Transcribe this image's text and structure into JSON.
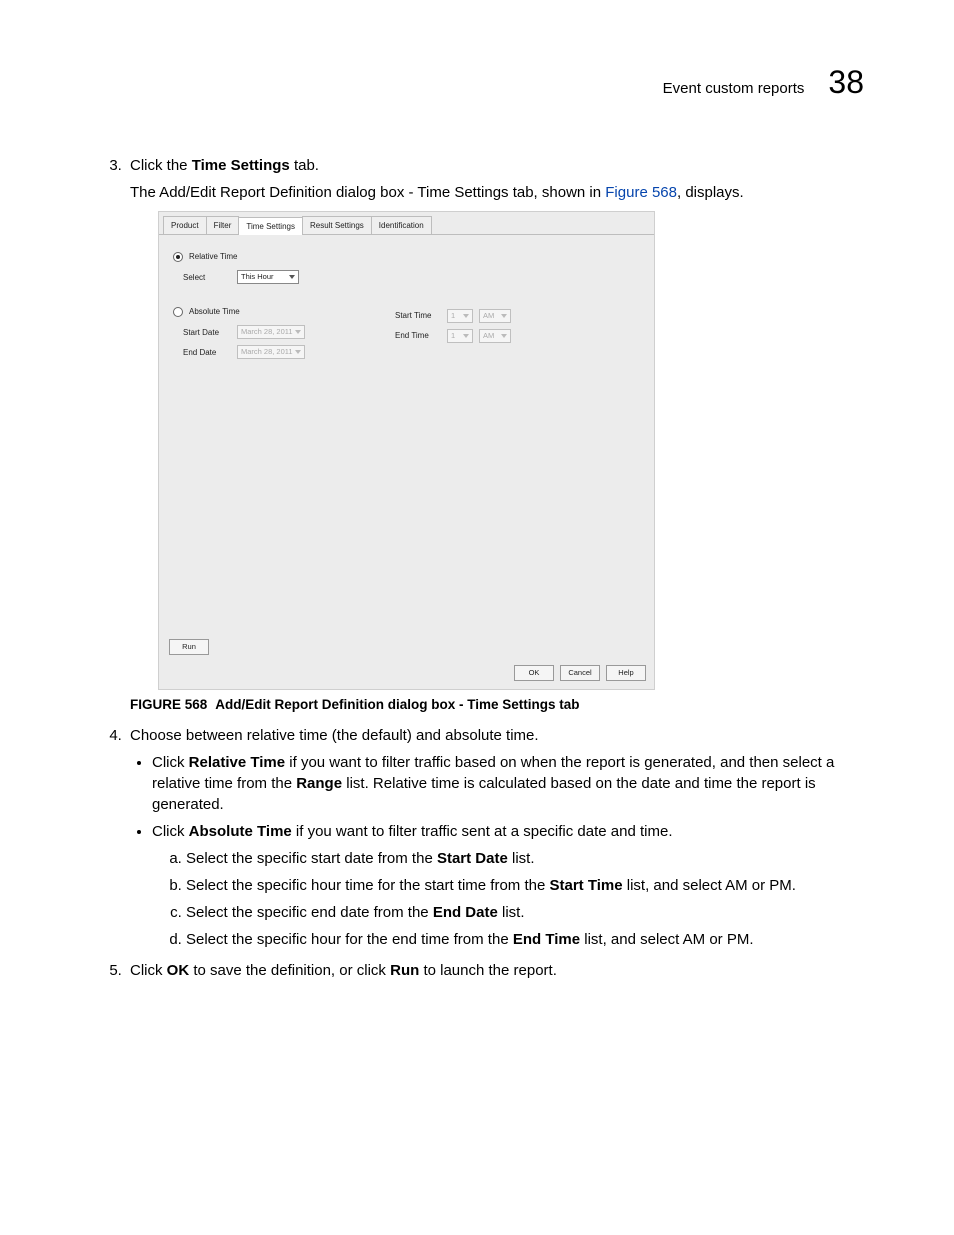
{
  "header": {
    "title": "Event custom reports",
    "chapter_number": "38"
  },
  "step3": {
    "prefix": "Click the ",
    "bold": "Time Settings",
    "suffix": " tab.",
    "desc_a": "The Add/Edit Report Definition dialog box - Time Settings tab, shown in ",
    "link": "Figure 568",
    "desc_b": ", displays."
  },
  "dialog": {
    "tabs": [
      "Product",
      "Filter",
      "Time Settings",
      "Result Settings",
      "Identification"
    ],
    "active_tab_index": 2,
    "relative_label": "Relative Time",
    "select_label": "Select",
    "select_value": "This Hour",
    "absolute_label": "Absolute Time",
    "start_date_label": "Start Date",
    "start_date_value": "March 28, 2011",
    "end_date_label": "End Date",
    "end_date_value": "March 28, 2011",
    "start_time_label": "Start Time",
    "end_time_label": "End Time",
    "hour_value": "1",
    "ampm_value": "AM",
    "run_btn": "Run",
    "ok_btn": "OK",
    "cancel_btn": "Cancel",
    "help_btn": "Help"
  },
  "figure": {
    "label": "FIGURE 568",
    "caption": "Add/Edit Report Definition dialog box - Time Settings tab"
  },
  "step4": {
    "text": "Choose between relative time (the default) and absolute time.",
    "b1_a": "Click ",
    "b1_bold1": "Relative Time",
    "b1_b": " if you want to filter traffic based on when the report is generated, and then select a relative time from the ",
    "b1_bold2": "Range",
    "b1_c": " list. Relative time is calculated based on the date and time the report is generated.",
    "b2_a": "Click ",
    "b2_bold": "Absolute Time",
    "b2_b": " if you want to filter traffic sent at a specific date and time.",
    "sa_a": "Select the specific start date from the ",
    "sa_bold": "Start Date",
    "sa_b": " list.",
    "sb_a": "Select the specific hour time for the start time from the ",
    "sb_bold": "Start Time",
    "sb_b": " list, and select AM or PM.",
    "sc_a": "Select the specific end date from the ",
    "sc_bold": "End Date",
    "sc_b": " list.",
    "sd_a": "Select the specific hour for the end time from the ",
    "sd_bold": "End Time",
    "sd_b": " list, and select AM or PM."
  },
  "step5": {
    "a": "Click ",
    "bold1": "OK",
    "b": " to save the definition, or click ",
    "bold2": "Run",
    "c": " to launch the report."
  }
}
